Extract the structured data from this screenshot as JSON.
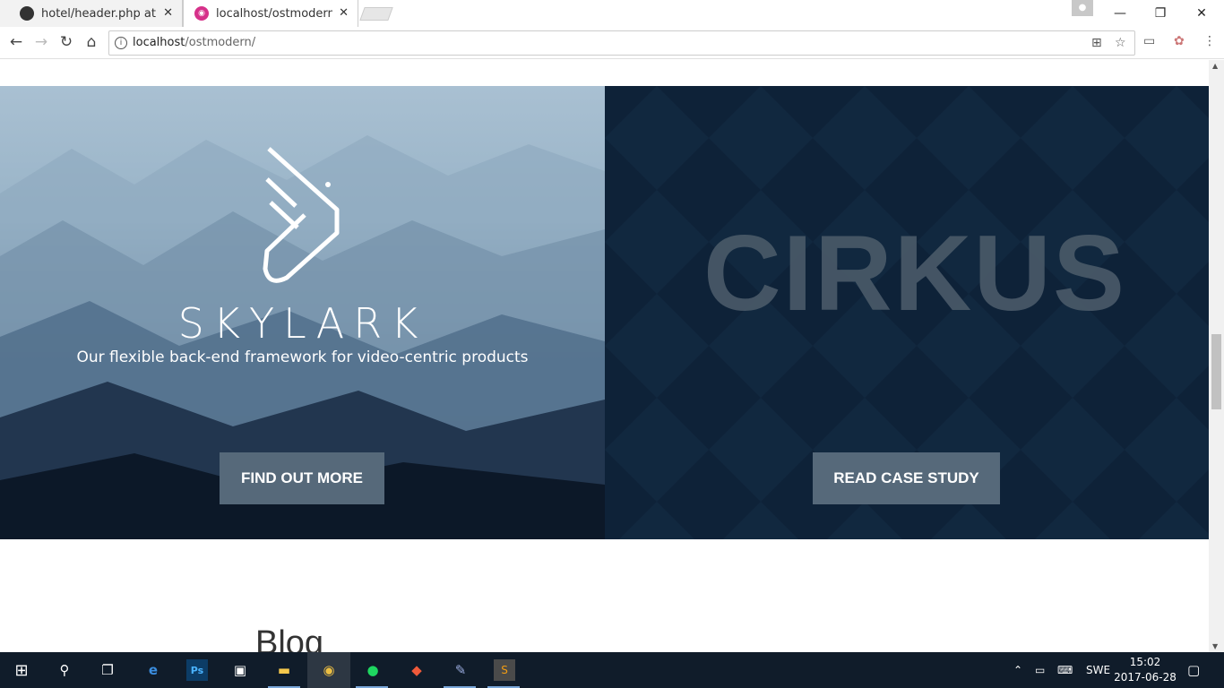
{
  "browser": {
    "tabs": [
      {
        "label": "hotel/header.php at mas",
        "close": "✕"
      },
      {
        "label": "localhost/ostmodern/",
        "close": "✕"
      }
    ],
    "url_host": "localhost",
    "url_path": "/ostmodern/"
  },
  "hero": {
    "left": {
      "brand": "SKYLARK",
      "tagline": "Our flexible back-end framework for video-centric products",
      "button": "FIND OUT MORE"
    },
    "right": {
      "logo_text": "CIRKUS",
      "button": "READ CASE STUDY"
    }
  },
  "blog_heading": "Blog",
  "taskbar": {
    "language": "SWE",
    "time": "15:02",
    "date": "2017-06-28"
  },
  "icons": [
    "github-icon",
    "ost-icon",
    "back-icon",
    "forward-icon",
    "reload-icon",
    "home-icon",
    "info-icon",
    "translate-icon",
    "star-icon",
    "cast-icon",
    "extension-icon",
    "menu-icon",
    "windows-icon",
    "search-icon",
    "taskview-icon",
    "edge-icon",
    "photoshop-icon",
    "store-icon",
    "explorer-icon",
    "chrome-icon",
    "spotify-icon",
    "git-icon",
    "paint-icon",
    "sublime-icon"
  ],
  "colors": {
    "button_bg": "#56697a",
    "right_panel": "#0e2238",
    "taskbar": "#101c2a"
  }
}
